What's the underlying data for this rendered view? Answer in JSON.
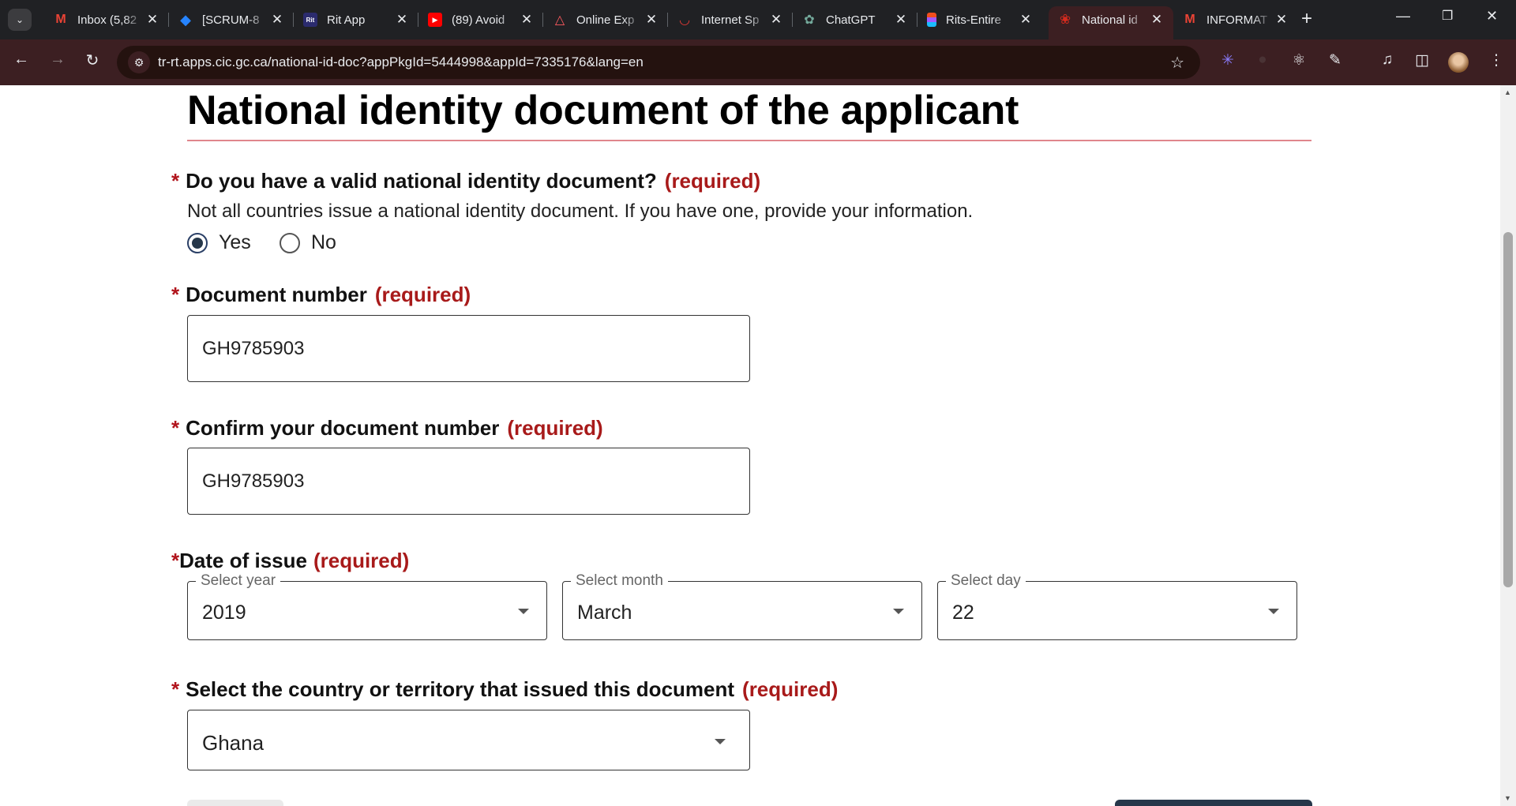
{
  "browser": {
    "tabs": [
      {
        "title": "Inbox (5,82",
        "icon": "gmail-icon",
        "color": "#ea4335"
      },
      {
        "title": "[SCRUM-8",
        "icon": "jira-icon",
        "color": "#2684ff"
      },
      {
        "title": "Rit App",
        "icon": "rit-icon",
        "color": "#2b2b6e"
      },
      {
        "title": "(89) Avoid",
        "icon": "youtube-icon",
        "color": "#ff0000"
      },
      {
        "title": "Online Exp",
        "icon": "airbnb-icon",
        "color": "#ff5a5f"
      },
      {
        "title": "Internet Sp",
        "icon": "speedtest-icon",
        "color": "#e53935"
      },
      {
        "title": "ChatGPT",
        "icon": "chatgpt-icon",
        "color": "#74aa9c"
      },
      {
        "title": "Rits-Entire",
        "icon": "figma-icon",
        "color": "#f24e1e"
      },
      {
        "title": "National id",
        "icon": "maple-leaf-icon",
        "color": "#d52b1e"
      },
      {
        "title": "INFORMAT",
        "icon": "gmail-icon",
        "color": "#ea4335"
      }
    ],
    "url": "tr-rt.apps.cic.gc.ca/national-id-doc?appPkgId=5444998&appId=7335176&lang=en"
  },
  "form": {
    "title": "National identity document of the applicant",
    "required_label": "(required)",
    "asterisk": "*",
    "has_doc": {
      "question": "Do you have a valid national identity document?",
      "hint": "Not all countries issue a national identity document. If you have one, provide your information.",
      "options": [
        "Yes",
        "No"
      ],
      "selected": "Yes"
    },
    "doc_number": {
      "label": "Document number",
      "value": "GH9785903"
    },
    "confirm_number": {
      "label": "Confirm your document number",
      "value": "GH9785903"
    },
    "date_of_issue": {
      "label": "Date of issue",
      "year": {
        "legend": "Select year",
        "value": "2019"
      },
      "month": {
        "legend": "Select month",
        "value": "March"
      },
      "day": {
        "legend": "Select day",
        "value": "22"
      }
    },
    "country": {
      "label": "Select the country or territory that issued this document",
      "value": "Ghana"
    }
  }
}
